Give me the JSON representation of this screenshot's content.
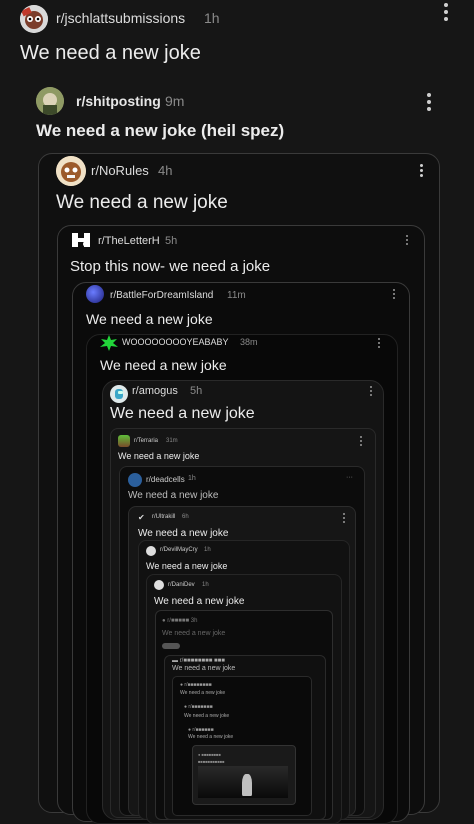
{
  "colors": {
    "background": "#161616",
    "card_border": "#3a3a3a",
    "accent_orange": "#ff5700"
  },
  "posts": [
    {
      "community": "r/jschlattsubmissions",
      "time": "1h",
      "title": "We need a new joke"
    },
    {
      "community": "r/shitposting",
      "time": "9m",
      "title": "We need a new joke (heil spez)"
    },
    {
      "community": "r/NoRules",
      "time": "4h",
      "title": "We need a new joke"
    },
    {
      "community": "r/TheLetterH",
      "time": "5h",
      "title": "Stop this now- we need a joke"
    },
    {
      "community": "r/BattleForDreamIsland",
      "time": "11m",
      "title": "We need a new joke"
    },
    {
      "community": "WOOOOOOOOYEABABY",
      "time": "38m",
      "title": "We need a new joke"
    },
    {
      "community": "r/amogus",
      "time": "5h",
      "title": "We need a new joke"
    },
    {
      "community": "r/Terraria",
      "time": "31m",
      "title": "We need a new joke"
    },
    {
      "community": "r/deadcells",
      "time": "1h",
      "title": "We need a new joke"
    },
    {
      "community": "r/Ultrakill",
      "time": "6h",
      "title": "We need a new joke"
    },
    {
      "community": "r/DevilMayCry",
      "time": "1h",
      "title": "We need a new joke"
    },
    {
      "community": "r/DaniDev",
      "time": "1h",
      "title": "We need a new joke"
    }
  ],
  "icons": {
    "more": "vertical-dots-icon",
    "h_logo": "letter-h-icon"
  }
}
